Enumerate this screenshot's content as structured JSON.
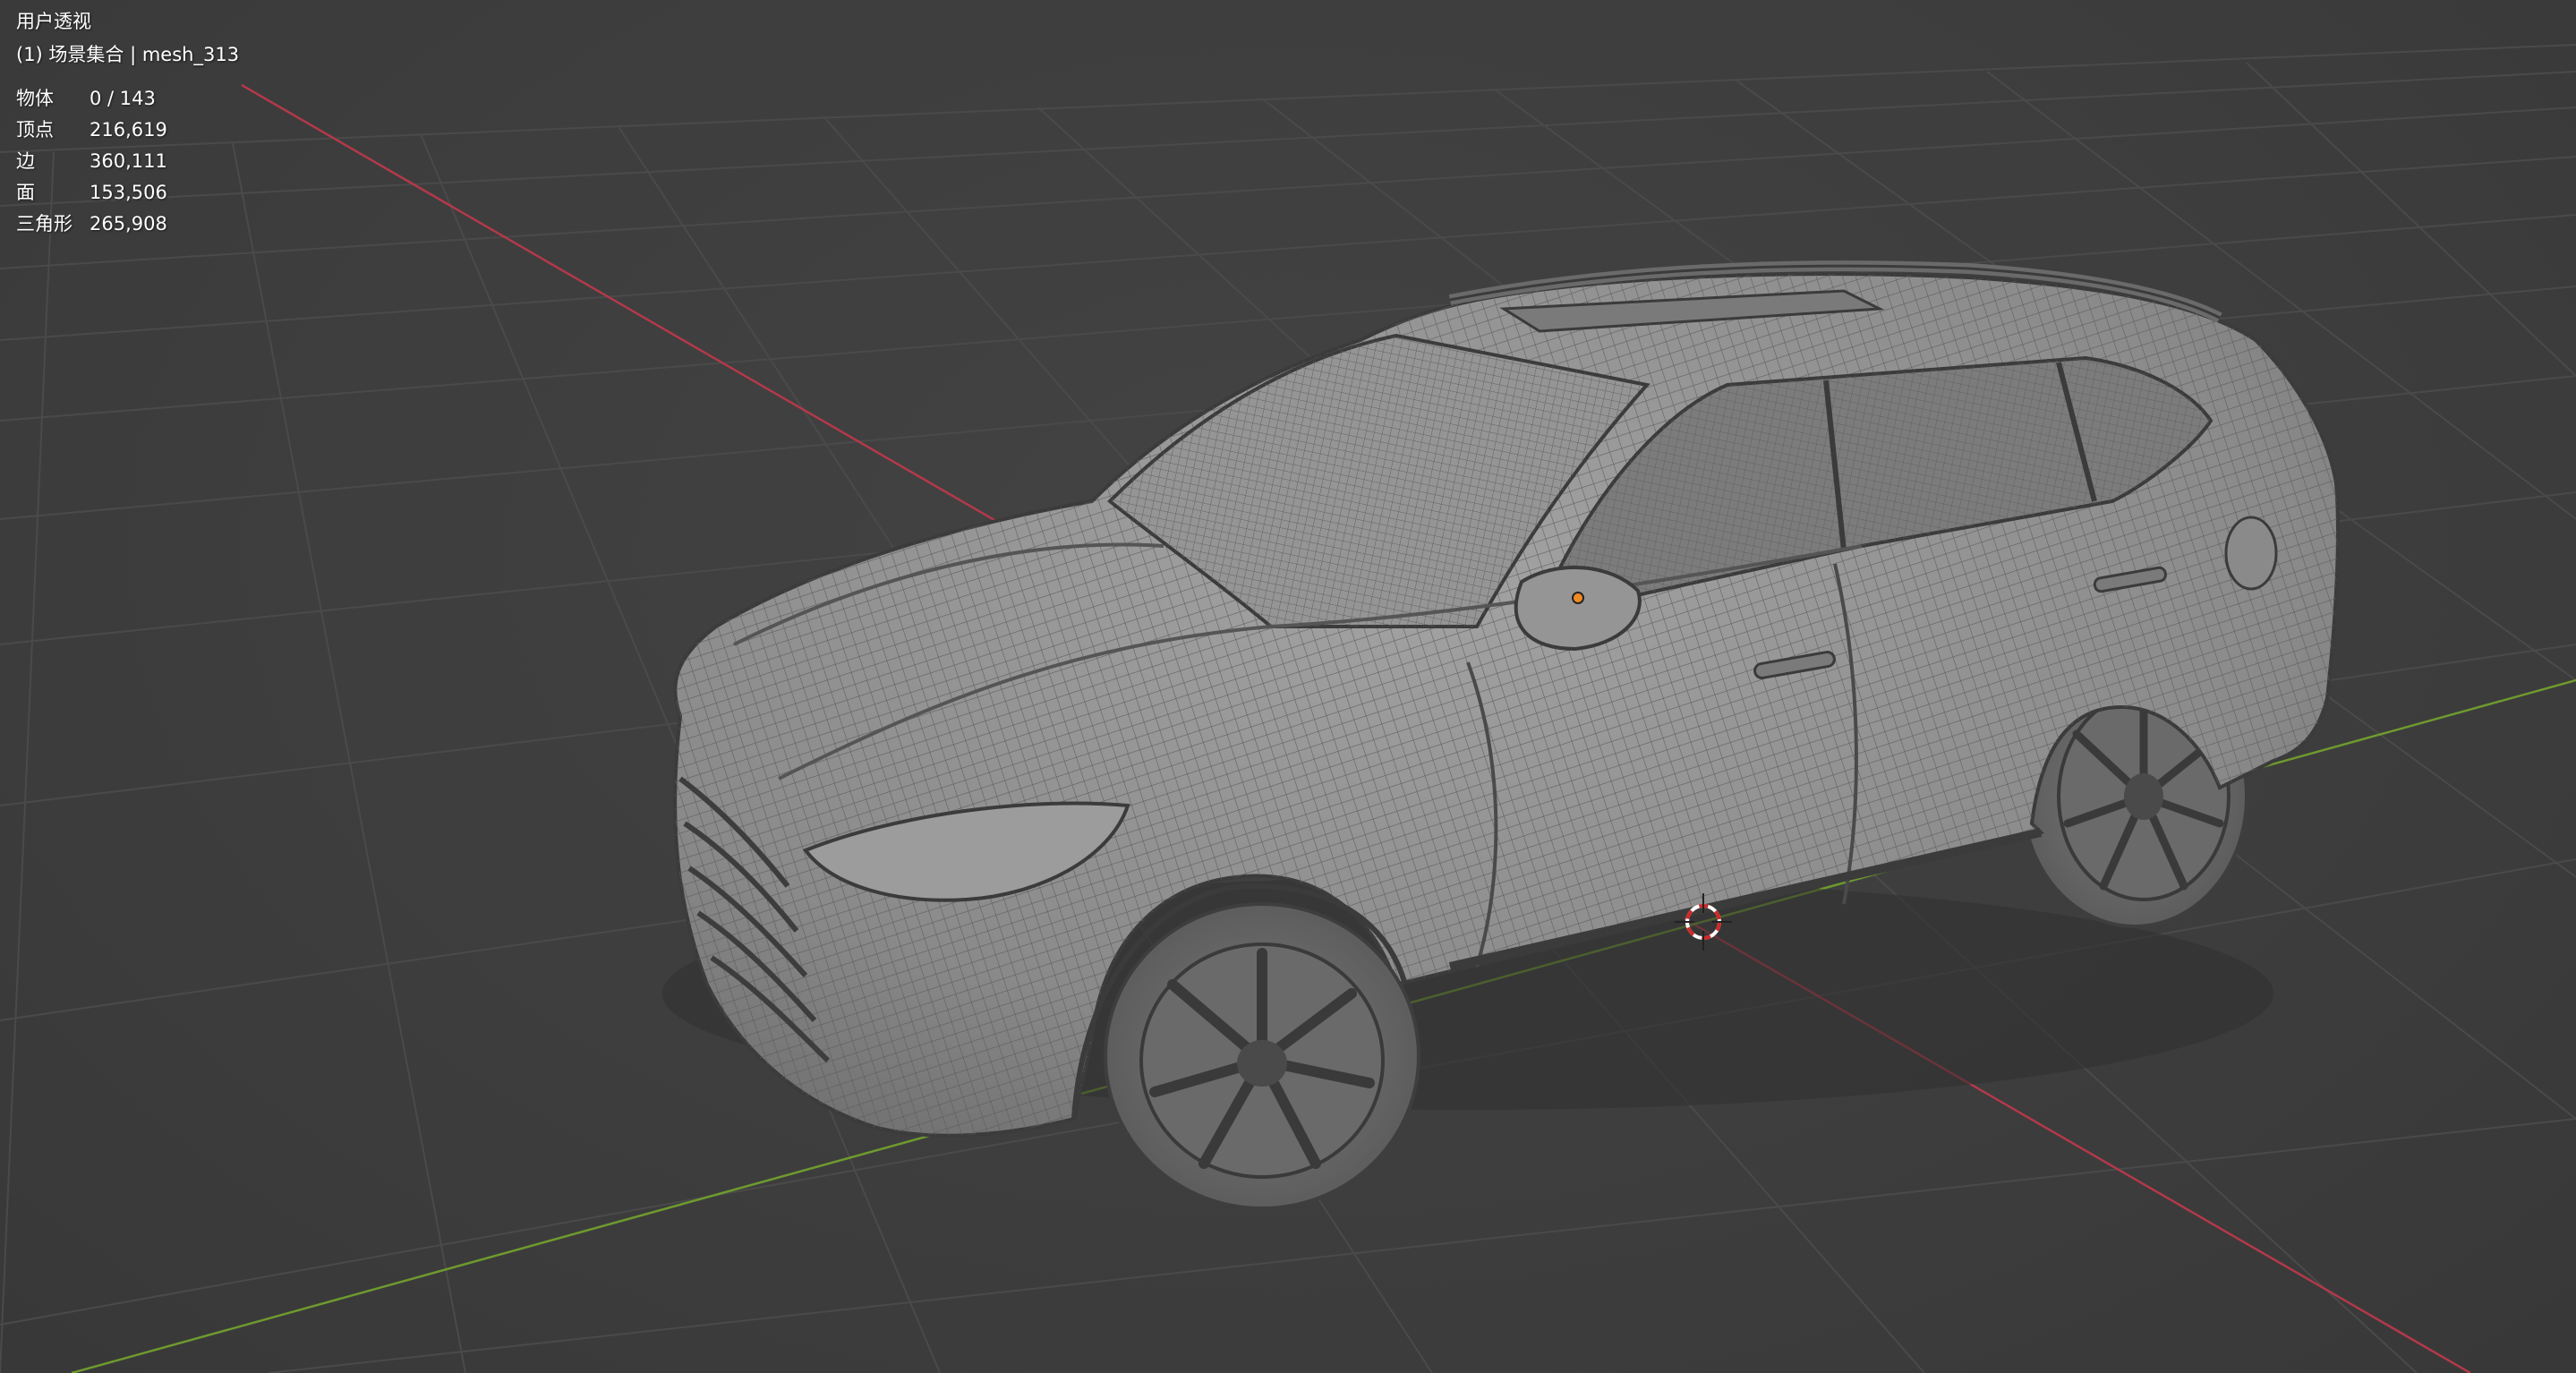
{
  "viewport": {
    "view_name": "用户透视",
    "collection_line": "(1) 场景集合 | mesh_313"
  },
  "statistics": {
    "objects": {
      "label": "物体",
      "value": "0 / 143"
    },
    "vertices": {
      "label": "顶点",
      "value": "216,619"
    },
    "edges": {
      "label": "边",
      "value": "360,111"
    },
    "faces": {
      "label": "面",
      "value": "153,506"
    },
    "triangles": {
      "label": "三角形",
      "value": "265,908"
    }
  },
  "colors": {
    "background": "#3d3d3d",
    "grid": "#4a4a4a",
    "x_axis": "#b2394a",
    "y_axis": "#6e9a2e",
    "mesh_body": "#8d8d8d",
    "mesh_wire": "#4e4e4e",
    "origin_dot": "#f08a24"
  },
  "icons": {
    "cursor": "3d-cursor-icon",
    "origin": "object-origin-icon"
  }
}
